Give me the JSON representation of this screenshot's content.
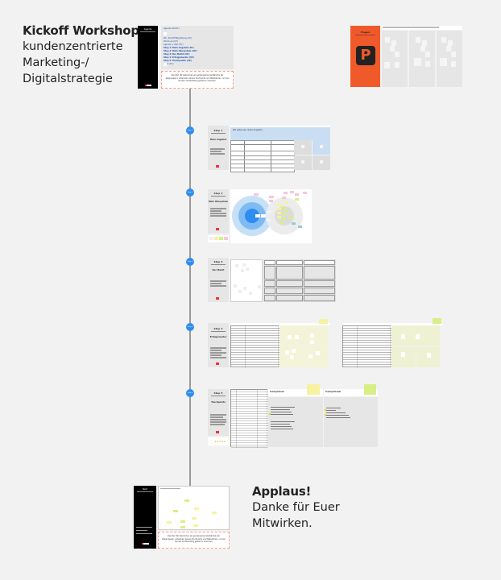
{
  "title": {
    "heading": "Kickoff Workshop",
    "line1": "kundenzentrierte",
    "line2": "Marketing-/",
    "line3": "Digitalstrategie"
  },
  "ending": {
    "heading": "Applaus!",
    "line1": "Danke für Euer",
    "line2": "Mitwirken."
  },
  "agenda": {
    "sidebar_label": "Agenda",
    "heading": "Agenda 10:00-?",
    "items": [
      "Wir, Kickoff-Begrüßung (15')",
      "Warm-up (10')",
      "Agenda + Ziel (15')",
      "Step 1: Mein Angebot (30')",
      "Step 2: Mein Ökosystem (30')",
      "Step 3: Der Markt (30')",
      "Step 4: Erfolgsmuster (30')",
      "Step 5: Touchpoints (30')",
      "Next (15')"
    ],
    "note": "Das Ziel: Wir bekommen ein gemeinsames Verständnis der Zielgruppe(n), entwickeln daraus Touchpoints und Maßnahmen, um den Kunden mit Marketing gezielt zu erreichen."
  },
  "fragen": {
    "label": "Fragen",
    "icon": "P"
  },
  "steps": [
    {
      "marker": "Step 1",
      "label": "Step 1",
      "subtitle": "Mein Angebot",
      "prompt": "Wir sehen wir unser Angebot..."
    },
    {
      "marker": "Step 2",
      "label": "Step 2",
      "subtitle": "Mein Ökosystem"
    },
    {
      "marker": "Step 3",
      "label": "Step 3",
      "subtitle": "Der Markt"
    },
    {
      "marker": "Step 4",
      "label": "Step 4",
      "subtitle": "Erfolgsmuster"
    },
    {
      "marker": "Step 5",
      "label": "Step 5",
      "subtitle": "Touchpoints",
      "col_a": "Touchpoint-Ist",
      "col_b": "Touchpoint-Soll"
    }
  ],
  "final_board": {
    "sidebar_label": "Next"
  },
  "colors": {
    "accent_blue": "#2d8ef0",
    "fragen_orange": "#f05a2a",
    "sticky_yellow": "#f7f2a0",
    "sticky_green": "#d7ef86",
    "sticky_pink": "#f7c6da",
    "sticky_teal": "#8fd1cb"
  }
}
